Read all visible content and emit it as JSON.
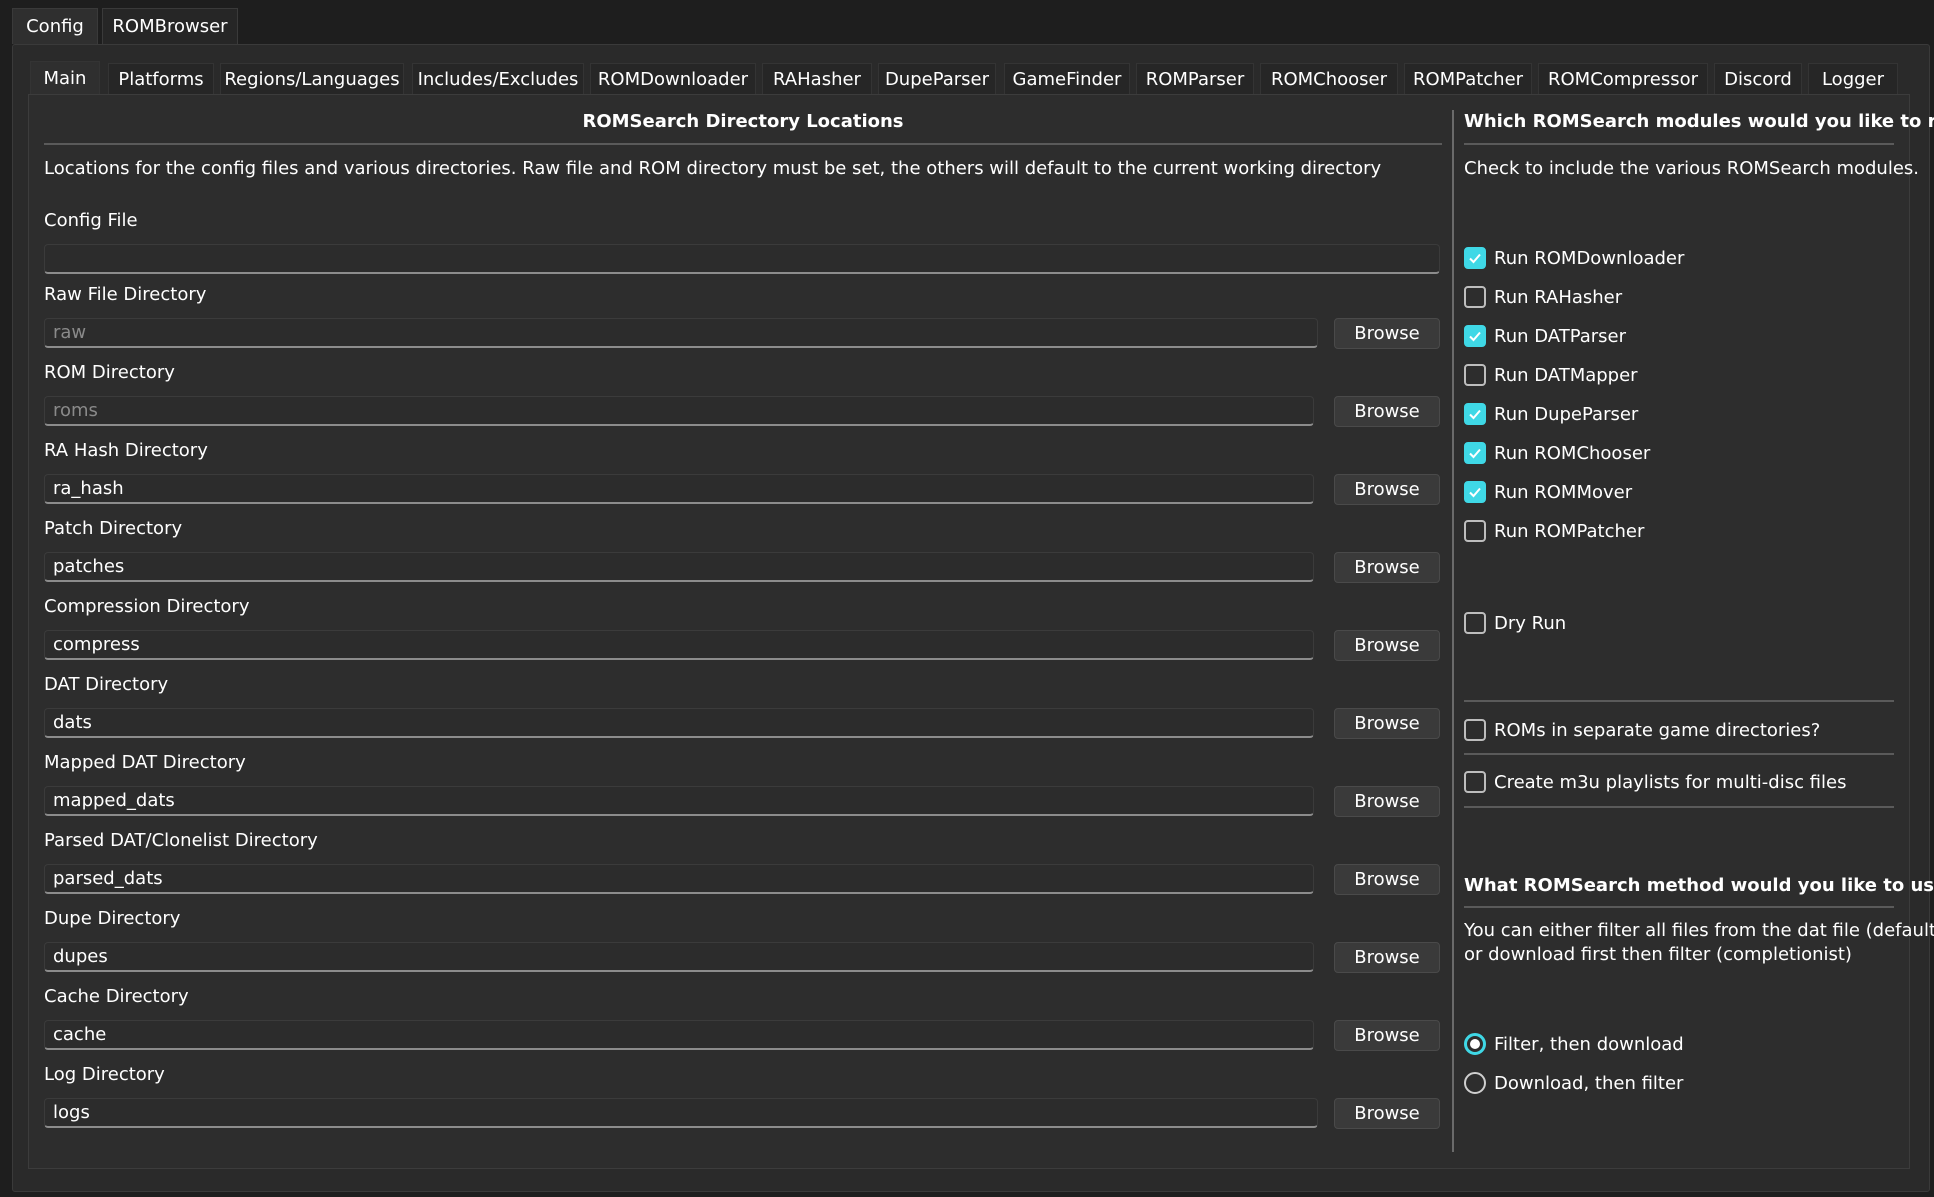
{
  "outer_tabs": [
    {
      "label": "Config",
      "active": true
    },
    {
      "label": "ROMBrowser",
      "active": false
    }
  ],
  "inner_tabs": [
    {
      "label": "Main",
      "active": true
    },
    {
      "label": "Platforms"
    },
    {
      "label": "Regions/Languages"
    },
    {
      "label": "Includes/Excludes"
    },
    {
      "label": "ROMDownloader"
    },
    {
      "label": "RAHasher"
    },
    {
      "label": "DupeParser"
    },
    {
      "label": "GameFinder"
    },
    {
      "label": "ROMParser"
    },
    {
      "label": "ROMChooser"
    },
    {
      "label": "ROMPatcher"
    },
    {
      "label": "ROMCompressor"
    },
    {
      "label": "Discord"
    },
    {
      "label": "Logger"
    }
  ],
  "dirs": {
    "title": "ROMSearch Directory Locations",
    "description": "Locations for the config files and various directories. Raw file and ROM directory must be set, the others will default to the current working directory",
    "config_file_label": "Config File",
    "config_file_value": "",
    "browse_label": "Browse",
    "fields": [
      {
        "label": "Raw File Directory",
        "value": "raw",
        "placeholder": true
      },
      {
        "label": "ROM Directory",
        "value": "roms",
        "placeholder": true
      },
      {
        "label": "RA Hash Directory",
        "value": "ra_hash"
      },
      {
        "label": "Patch Directory",
        "value": "patches"
      },
      {
        "label": "Compression Directory",
        "value": "compress"
      },
      {
        "label": "DAT Directory",
        "value": "dats"
      },
      {
        "label": "Mapped DAT Directory",
        "value": "mapped_dats"
      },
      {
        "label": "Parsed DAT/Clonelist Directory",
        "value": "parsed_dats"
      },
      {
        "label": "Dupe Directory",
        "value": "dupes"
      },
      {
        "label": "Cache Directory",
        "value": "cache"
      },
      {
        "label": "Log Directory",
        "value": "logs"
      }
    ]
  },
  "modules": {
    "title": "Which ROMSearch modules would you like to run?",
    "description": "Check to include the various ROMSearch modules.",
    "items": [
      {
        "label": "Run ROMDownloader",
        "checked": true
      },
      {
        "label": "Run RAHasher",
        "checked": false
      },
      {
        "label": "Run DATParser",
        "checked": true
      },
      {
        "label": "Run DATMapper",
        "checked": false
      },
      {
        "label": "Run DupeParser",
        "checked": true
      },
      {
        "label": "Run ROMChooser",
        "checked": true
      },
      {
        "label": "Run ROMMover",
        "checked": true
      },
      {
        "label": "Run ROMPatcher",
        "checked": false
      }
    ],
    "dry_run": {
      "label": "Dry Run",
      "checked": false
    },
    "separate_dirs": {
      "label": "ROMs in separate game directories?",
      "checked": false
    },
    "m3u": {
      "label": "Create m3u playlists for multi-disc files",
      "checked": false
    }
  },
  "method": {
    "title": "What ROMSearch method would you like to use?",
    "description_line1": "You can either filter all files from the dat file (default),",
    "description_line2": "or download first then filter (completionist)",
    "options": [
      {
        "label": "Filter, then download",
        "selected": true
      },
      {
        "label": "Download, then filter",
        "selected": false
      }
    ]
  },
  "colors": {
    "accent": "#3fd8e6",
    "background": "#2d2d2d"
  }
}
